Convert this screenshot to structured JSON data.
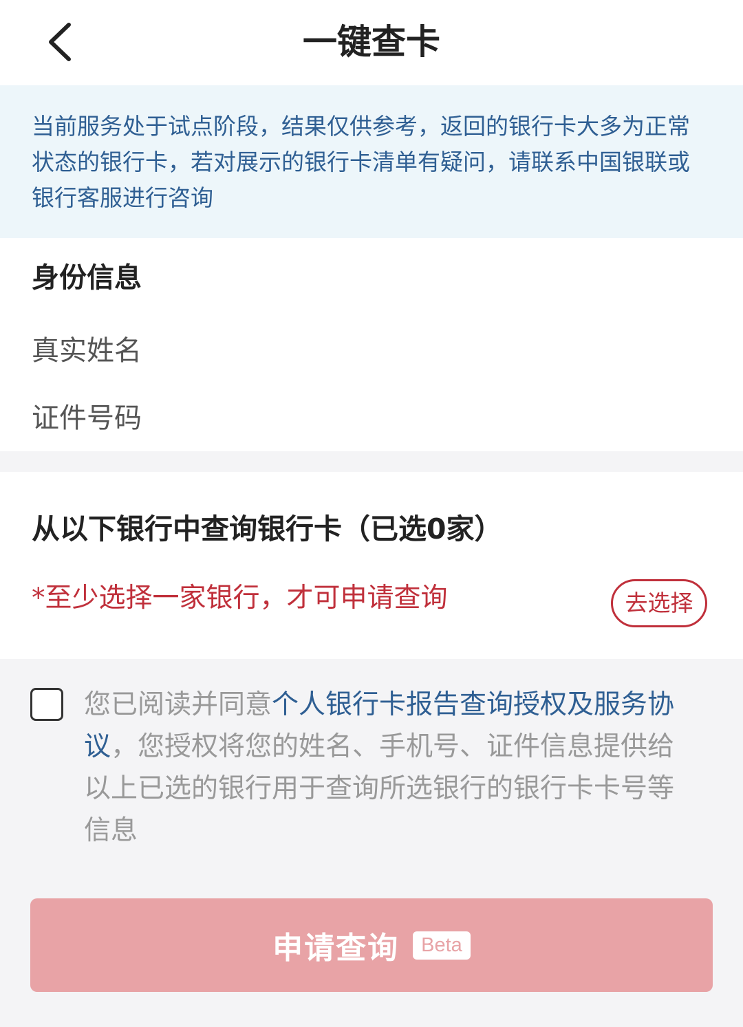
{
  "header": {
    "title": "一键查卡",
    "back_icon": "chevron-left-icon"
  },
  "notice": {
    "text": "当前服务处于试点阶段，结果仅供参考，返回的银行卡大多为正常状态的银行卡，若对展示的银行卡清单有疑问，请联系中国银联或银行客服进行咨询"
  },
  "identity": {
    "section_title": "身份信息",
    "name_label": "真实姓名",
    "name_value": "",
    "id_label": "证件号码",
    "id_value": ""
  },
  "banks": {
    "title": "从以下银行中查询银行卡（已选0家）",
    "hint": "*至少选择一家银行，才可申请查询",
    "choose_label": "去选择"
  },
  "agreement": {
    "checked": false,
    "prefix": "您已阅读并同意",
    "link": "个人银行卡报告查询授权及服务协议",
    "suffix": "，您授权将您的姓名、手机号、证件信息提供给以上已选的银行用于查询所选银行的银行卡卡号等信息"
  },
  "submit": {
    "label": "申请查询",
    "badge": "Beta"
  },
  "colors": {
    "accent_red": "#c0303b",
    "link_blue": "#2f5f93",
    "notice_bg": "#edf6fa",
    "submit_disabled": "#e8a3a6"
  }
}
